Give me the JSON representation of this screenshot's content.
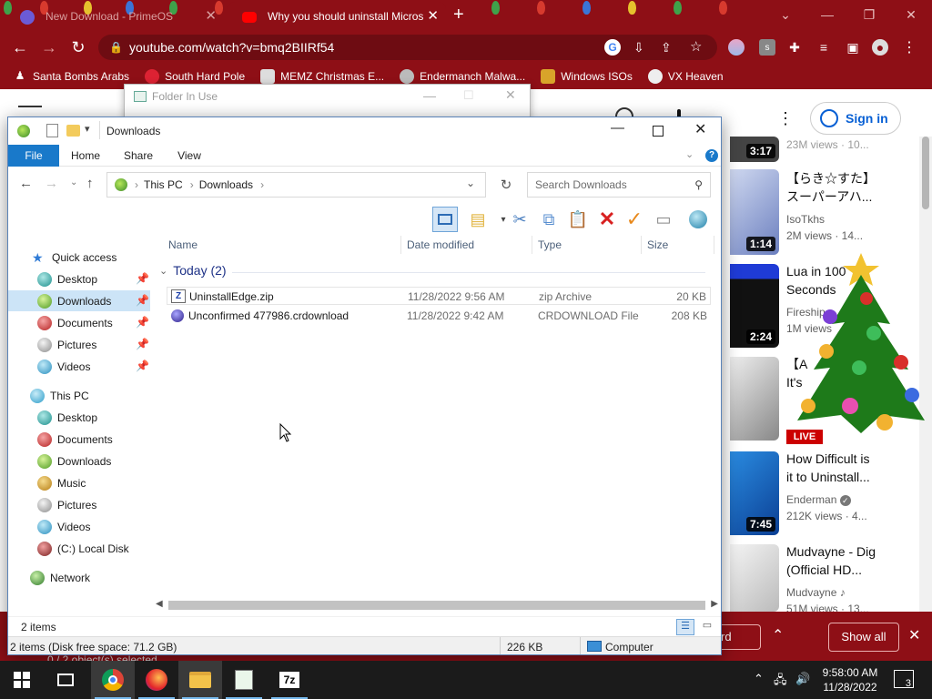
{
  "browser": {
    "tabs": [
      {
        "title": "New Download - PrimeOS",
        "active": false
      },
      {
        "title": "Why you should uninstall Micros",
        "active": true
      }
    ],
    "new_tab": "+",
    "url": "youtube.com/watch?v=bmq2BIIRf54",
    "bookmarks": [
      {
        "label": "Santa Bombs Arabs",
        "icon": "santa-icon"
      },
      {
        "label": "South Hard Pole",
        "icon": "ball-icon"
      },
      {
        "label": "MEMZ Christmas E...",
        "icon": "image-icon"
      },
      {
        "label": "Endermanch Malwa...",
        "icon": "cat-icon"
      },
      {
        "label": "Windows ISOs",
        "icon": "lamp-icon"
      },
      {
        "label": "VX Heaven",
        "icon": "skull-icon"
      }
    ]
  },
  "youtube": {
    "sign_in": "Sign in",
    "videos": [
      {
        "duration": "3:17",
        "title": "",
        "channel": "",
        "meta": "23M views · 10..."
      },
      {
        "duration": "1:14",
        "title": "【らき☆すた】",
        "title2": "スーパーアハ...",
        "channel": "IsoTkhs",
        "meta": "2M views · 14..."
      },
      {
        "duration": "2:24",
        "title": "Lua in 100",
        "title2": "Seconds",
        "channel": "Fireship",
        "meta": "1M views"
      },
      {
        "duration": "LIVE",
        "title": "【A",
        "title2": "It's",
        "channel": "",
        "meta": ""
      },
      {
        "duration": "7:45",
        "title": "How Difficult is",
        "title2": "it to Uninstall...",
        "channel": "Enderman",
        "meta": "212K views · 4..."
      },
      {
        "duration": "",
        "title": "Mudvayne - Dig",
        "title2": "(Official HD...",
        "channel": "Mudvayne",
        "meta": "51M views · 13..."
      }
    ],
    "download_bar": {
      "partial_label": "rd",
      "show_all": "Show all"
    }
  },
  "folder_in_use": {
    "title": "Folder In Use"
  },
  "explorer": {
    "title": "Downloads",
    "ribbon": {
      "file": "File",
      "home": "Home",
      "share": "Share",
      "view": "View"
    },
    "breadcrumb": [
      "This PC",
      "Downloads"
    ],
    "search_placeholder": "Search Downloads",
    "nav": {
      "quick_access": "Quick access",
      "quick_items": [
        "Desktop",
        "Downloads",
        "Documents",
        "Pictures",
        "Videos"
      ],
      "this_pc": "This PC",
      "pc_items": [
        "Desktop",
        "Documents",
        "Downloads",
        "Music",
        "Pictures",
        "Videos",
        "(C:) Local Disk"
      ],
      "network": "Network"
    },
    "columns": {
      "name": "Name",
      "date": "Date modified",
      "type": "Type",
      "size": "Size"
    },
    "group": "Today (2)",
    "files": [
      {
        "name": "UninstallEdge.zip",
        "date": "11/28/2022 9:56 AM",
        "type": "zip Archive",
        "size": "20 KB"
      },
      {
        "name": "Unconfirmed 477986.crdownload",
        "date": "11/28/2022 9:42 AM",
        "type": "CRDOWNLOAD File",
        "size": "208 KB"
      }
    ],
    "item_count": "2 items",
    "status": {
      "left": "2 items (Disk free space: 71.2 GB)",
      "size": "226 KB",
      "location": "Computer"
    },
    "behind_status": "0 / 2 object(s) selected"
  },
  "taskbar": {
    "time": "9:58:00 AM",
    "date": "11/28/2022",
    "notifications": "3",
    "apps": [
      "start",
      "task-view",
      "chrome",
      "firefox",
      "file-explorer",
      "notepad",
      "7zip"
    ]
  }
}
